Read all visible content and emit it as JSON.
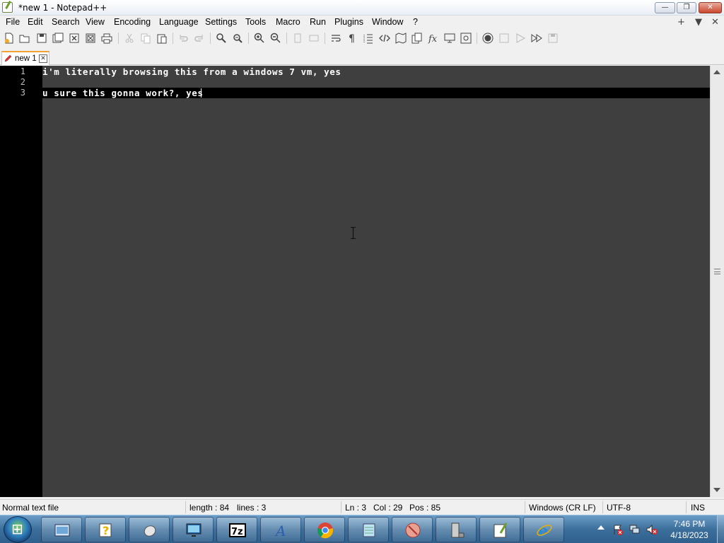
{
  "window": {
    "title": "*new 1 - Notepad++"
  },
  "menu": {
    "items": [
      "File",
      "Edit",
      "Search",
      "View",
      "Encoding",
      "Language",
      "Settings",
      "Tools",
      "Macro",
      "Run",
      "Plugins",
      "Window",
      "?"
    ],
    "right": [
      "+",
      "▼",
      "✕"
    ]
  },
  "toolbar": {
    "icons": [
      "new-file-icon",
      "open-file-icon",
      "save-icon",
      "save-all-icon",
      "close-icon",
      "close-all-icon",
      "print-icon",
      "cut-icon",
      "copy-icon",
      "paste-icon",
      "undo-icon",
      "redo-icon",
      "find-icon",
      "replace-icon",
      "zoom-in-icon",
      "zoom-out-icon",
      "sync-vertical-icon",
      "sync-horizontal-icon",
      "word-wrap-icon",
      "show-all-chars-icon",
      "indent-guide-icon",
      "xml-tag-icon",
      "document-map-icon",
      "clone-icon",
      "function-list-icon",
      "monitor-icon",
      "screenshot-icon",
      "record-macro-icon",
      "stop-macro-icon",
      "play-macro-icon",
      "run-macro-multiple-icon",
      "save-macro-icon"
    ]
  },
  "tabs": [
    {
      "label": "new 1",
      "close": "✕"
    }
  ],
  "editor": {
    "lines": [
      {
        "num": "1",
        "text": "i'm literally browsing this from a windows 7 vm, yes"
      },
      {
        "num": "2",
        "text": ""
      },
      {
        "num": "3",
        "text": "u sure this gonna work?, yes"
      }
    ]
  },
  "status": {
    "file_type": "Normal text file",
    "length": "length : 84",
    "lines": "lines : 3",
    "ln": "Ln : 3",
    "col": "Col : 29",
    "pos": "Pos : 85",
    "eol": "Windows (CR LF)",
    "encoding": "UTF-8",
    "mode": "INS"
  },
  "taskbar": {
    "apps": [
      "explorer-icon",
      "help-icon",
      "mouse-icon",
      "display-icon",
      "7zip-icon",
      "font-icon",
      "chrome-icon",
      "notepad-icon",
      "antivirus-icon",
      "server-icon",
      "notepadpp-icon",
      "ie-icon"
    ],
    "time": "7:46 PM",
    "date": "4/18/2023"
  },
  "colors": {
    "editor_bg": "#3f3f3f",
    "gutter_bg": "#000000",
    "text": "#ffffff",
    "tab_accent": "#f3a234"
  }
}
